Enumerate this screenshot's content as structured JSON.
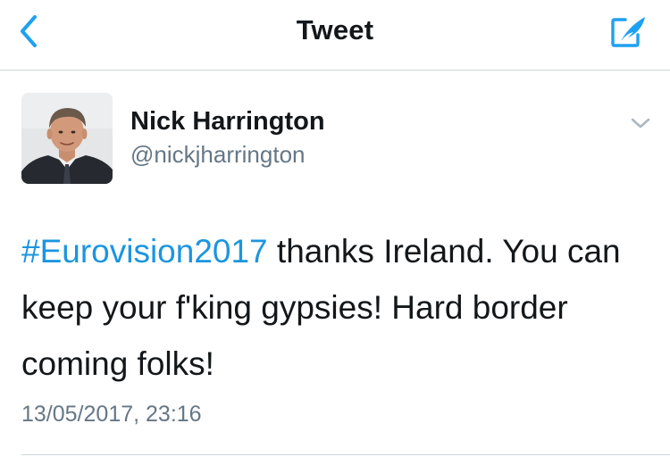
{
  "nav": {
    "title": "Tweet",
    "back_icon": "chevron-left-icon",
    "compose_icon": "compose-feather-icon",
    "accent_color": "#1da1f2"
  },
  "tweet": {
    "author": {
      "display_name": "Nick Harrington",
      "handle": "@nickjharrington"
    },
    "caret_icon": "chevron-down-icon",
    "hashtag": "#Eurovision2017",
    "text_rest": " thanks Ireland. You can keep your f'king gypsies! Hard border coming folks!",
    "timestamp": "13/05/2017, 23:16",
    "hashtag_color": "#1b95e0"
  }
}
